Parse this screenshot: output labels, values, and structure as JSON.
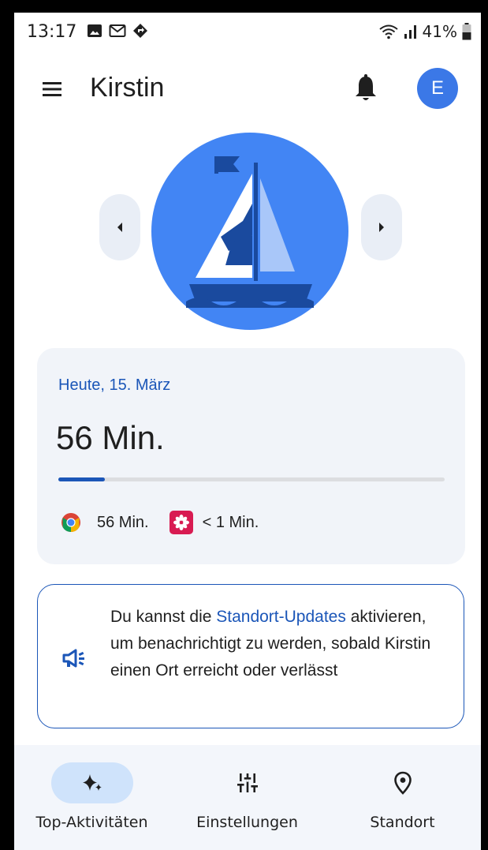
{
  "status_bar": {
    "time": "13:17",
    "left_icons": [
      "gallery-icon",
      "gmail-icon",
      "location-diamond-icon"
    ],
    "battery_percent": "41%",
    "right_icons": [
      "wifi-icon",
      "signal-icon",
      "battery-icon"
    ]
  },
  "header": {
    "menu_icon": "menu-icon",
    "title": "Kirstin",
    "bell_icon": "bell-icon",
    "avatar_letter": "E"
  },
  "hero": {
    "prev_icon": "caret-left-icon",
    "next_icon": "caret-right-icon",
    "illustration": "sailboat-icon"
  },
  "usage_card": {
    "date": "Heute, 15. März",
    "total": "56 Min.",
    "progress_fraction": 0.12,
    "apps": [
      {
        "icon": "chrome-icon",
        "time": "56 Min."
      },
      {
        "icon": "flower-app-icon",
        "time": "< 1 Min."
      }
    ]
  },
  "info_card": {
    "icon": "megaphone-icon",
    "text_before": "Du kannst die ",
    "link": "Standort-Updates",
    "text_after": " aktivieren, um benachrichtigt zu werden, sobald Kirstin einen Ort erreicht oder verlässt"
  },
  "bottom_nav": {
    "items": [
      {
        "label": "Top-Aktivitäten",
        "icon": "sparkle-icon",
        "active": true
      },
      {
        "label": "Einstellungen",
        "icon": "sliders-icon",
        "active": false
      },
      {
        "label": "Standort",
        "icon": "location-pin-icon",
        "active": false
      }
    ]
  },
  "colors": {
    "accent": "#1b56b8",
    "avatar_bg": "#3b78e7",
    "hero_bg": "#4285f4",
    "card_bg": "#f1f4f9",
    "nav_active_bg": "#cfe3fb"
  }
}
